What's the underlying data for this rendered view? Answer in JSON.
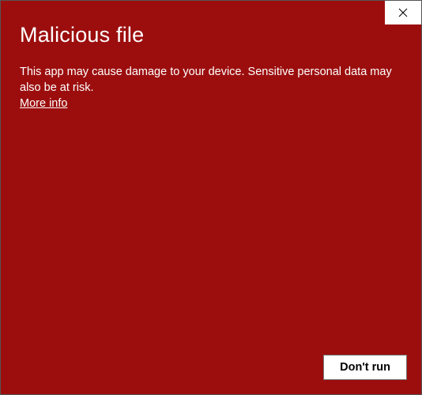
{
  "dialog": {
    "title": "Malicious file",
    "message": "This app may cause damage to your device. Sensitive personal data may also be at risk.",
    "more_info_label": "More info"
  },
  "buttons": {
    "dont_run_label": "Don't run"
  }
}
